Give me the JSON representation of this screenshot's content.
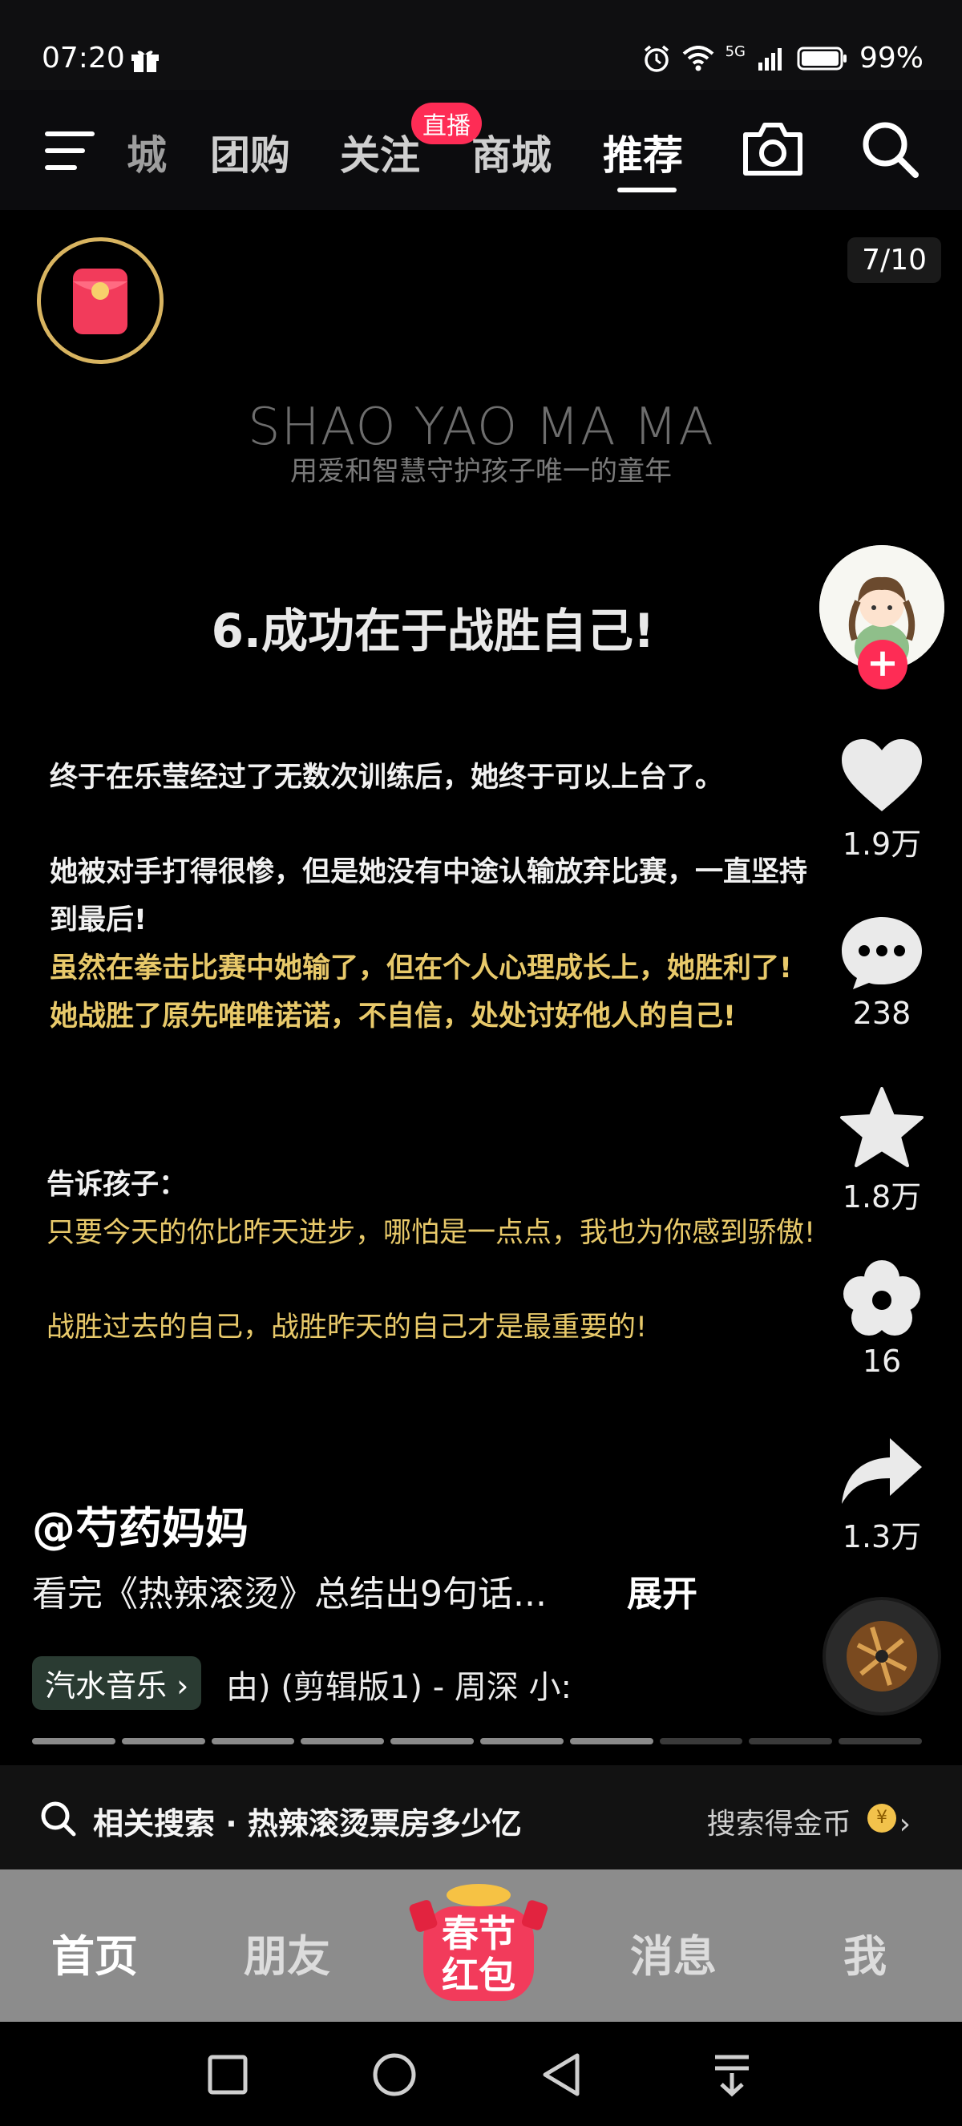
{
  "status": {
    "time": "07:20",
    "network": "5G",
    "battery": "99%"
  },
  "top_nav": {
    "tabs": [
      "城",
      "团购",
      "关注",
      "商城",
      "推荐"
    ],
    "active": "推荐",
    "live_badge": "直播"
  },
  "counter": "7/10",
  "slide": {
    "brand_title": "SHAO YAO MA MA",
    "brand_subtitle": "用爱和智慧守护孩子唯一的童年",
    "heading": "6.成功在于战胜自己!",
    "p1": "终于在乐莹经过了无数次训练后，她终于可以上台了。",
    "p2a": "她被对手打得很惨，但是她没有中途认输放弃比赛，一直坚持",
    "p2b": "到最后!",
    "p3a": "虽然在拳击比赛中她输了，但在个人心理成长上，她胜利了!",
    "p3b": "她战胜了原先唯唯诺诺，不自信，处处讨好他人的自己!",
    "p4": "告诉孩子：",
    "p5": "只要今天的你比昨天进步，哪怕是一点点，我也为你感到骄傲!",
    "p6": "战胜过去的自己，战胜昨天的自己才是最重要的!"
  },
  "rail": {
    "likes": "1.9万",
    "comments": "238",
    "favorites": "1.8万",
    "flower": "16",
    "shares": "1.3万"
  },
  "author": "@芍药妈妈",
  "description": "看完《热辣滚烫》总结出9句话...",
  "expand_label": "展开",
  "music": {
    "chip": "汽水音乐 ›",
    "track": "由) (剪辑版1) - 周深    小:"
  },
  "progress": {
    "total": 10,
    "current": 7
  },
  "related": {
    "label": "相关搜索 · 热辣滚烫票房多少亿",
    "right": "搜索得金币",
    "coin": "¥"
  },
  "bottom_nav": {
    "home": "首页",
    "friends": "朋友",
    "spring_line1": "春节",
    "spring_line2": "红包",
    "messages": "消息",
    "me": "我"
  }
}
